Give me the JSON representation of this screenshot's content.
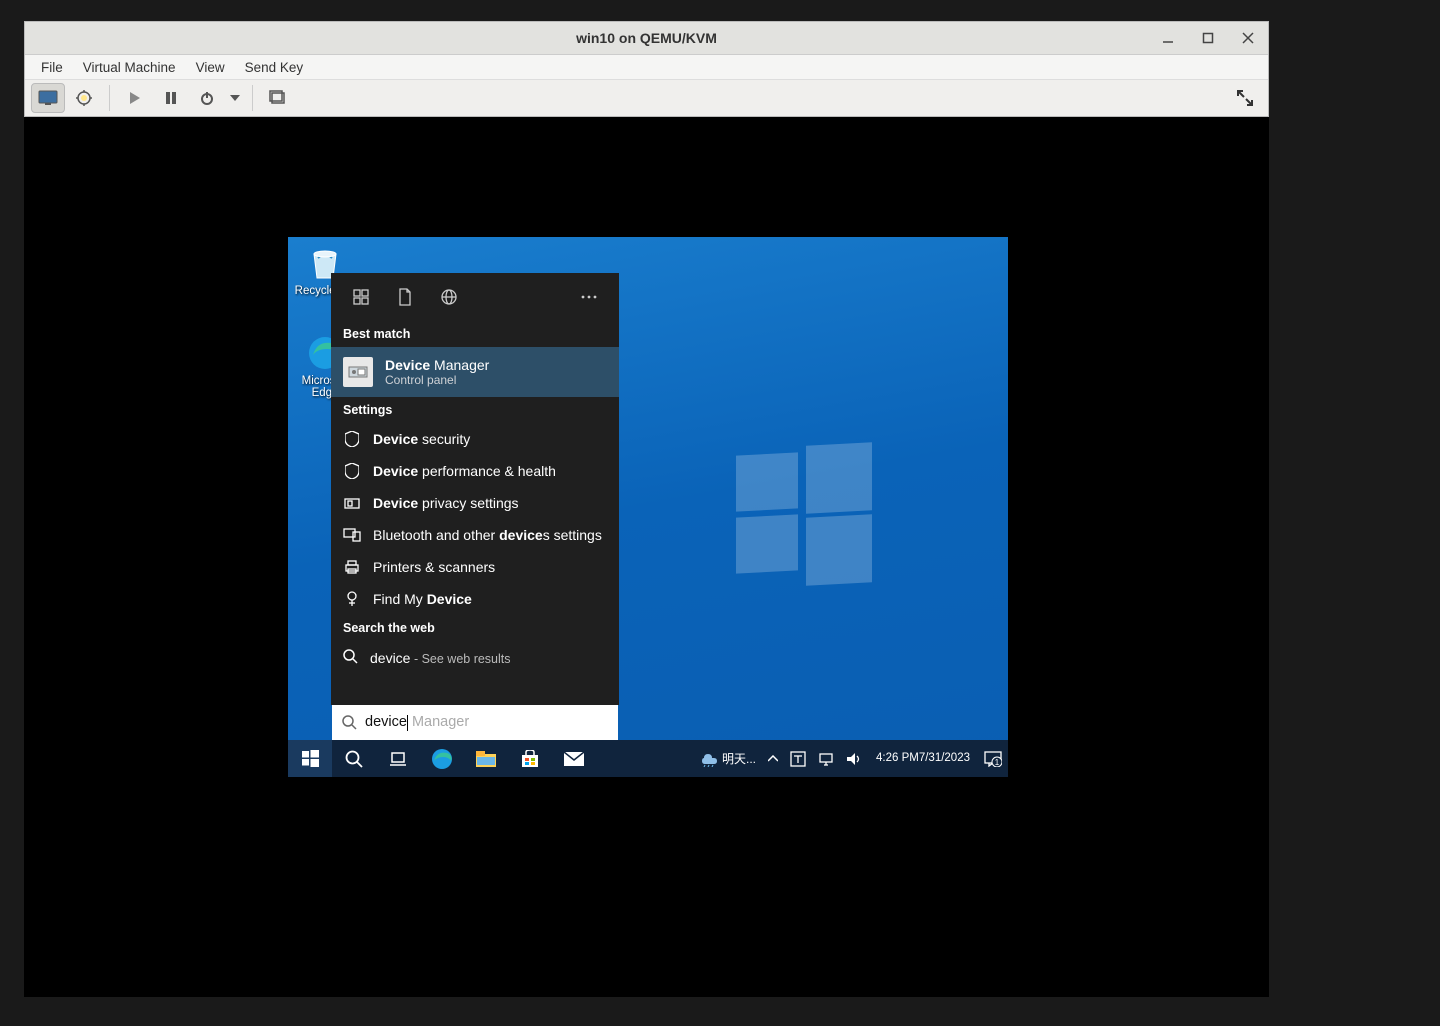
{
  "viewer": {
    "title": "win10 on QEMU/KVM",
    "menus": [
      "File",
      "Virtual Machine",
      "View",
      "Send Key"
    ]
  },
  "desktop": {
    "icons": [
      {
        "name": "Recycle Bin"
      },
      {
        "name": "Microsoft Edge"
      }
    ]
  },
  "search": {
    "sections": {
      "best_match": "Best match",
      "settings": "Settings",
      "search_web": "Search the web"
    },
    "best_match": {
      "title_bold": "Device",
      "title_rest": " Manager",
      "subtitle": "Control panel"
    },
    "settings_results": [
      {
        "pre": "",
        "bold": "Device",
        "post": " security",
        "icon": "shield"
      },
      {
        "pre": "",
        "bold": "Device",
        "post": " performance & health",
        "icon": "shield"
      },
      {
        "pre": "",
        "bold": "Device",
        "post": " privacy settings",
        "icon": "privacy"
      },
      {
        "pre": "Bluetooth and other ",
        "bold": "device",
        "post": "s settings",
        "icon": "bluetooth"
      },
      {
        "pre": "Printers & scanners",
        "bold": "",
        "post": "",
        "icon": "printer"
      },
      {
        "pre": "Find My ",
        "bold": "Device",
        "post": "",
        "icon": "location"
      }
    ],
    "web_result": {
      "term": "device",
      "sep": " - ",
      "rest": "See web results"
    },
    "input": {
      "typed": "device",
      "ghost": " Manager"
    }
  },
  "taskbar": {
    "weather": "明天...",
    "time": "4:26 PM",
    "date": "7/31/2023",
    "notification_count": "1"
  }
}
